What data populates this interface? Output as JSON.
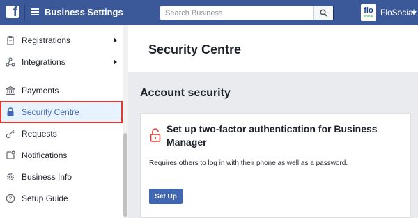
{
  "topbar": {
    "logo_letter": "f",
    "app_title": "Business Settings",
    "search_placeholder": "Search Business",
    "avatar_text_main": "flo",
    "avatar_text_sub": "social",
    "user_name": "FloSocial"
  },
  "sidebar": {
    "items": [
      {
        "label": "Registrations",
        "icon": "clipboard-icon",
        "has_submenu": true
      },
      {
        "label": "Integrations",
        "icon": "integrations-icon",
        "has_submenu": true
      },
      {
        "label": "Payments",
        "icon": "bank-icon",
        "has_submenu": false
      },
      {
        "label": "Security Centre",
        "icon": "lock-icon",
        "has_submenu": false,
        "active": true
      },
      {
        "label": "Requests",
        "icon": "key-icon",
        "has_submenu": false
      },
      {
        "label": "Notifications",
        "icon": "notification-icon",
        "has_submenu": false
      },
      {
        "label": "Business Info",
        "icon": "gear-icon",
        "has_submenu": false
      },
      {
        "label": "Setup Guide",
        "icon": "help-icon",
        "has_submenu": false
      }
    ]
  },
  "main": {
    "page_title": "Security Centre",
    "section_title": "Account security",
    "card": {
      "title": "Set up two-factor authentication for Business Manager",
      "description": "Requires others to log in with their phone as well as a password.",
      "button_label": "Set Up"
    }
  },
  "colors": {
    "brand": "#3b5998",
    "button": "#4267b2",
    "active_text": "#4267b2",
    "highlight_border": "#e03a2f",
    "lock_icon": "#e03a2f"
  }
}
